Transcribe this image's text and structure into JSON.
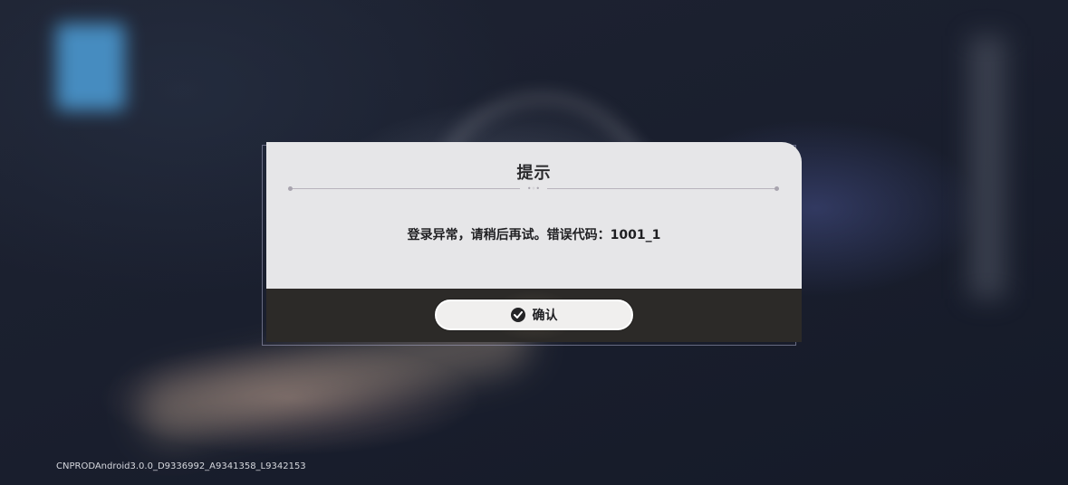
{
  "dialog": {
    "title": "提示",
    "message": "登录异常，请稍后再试。错误代码：1001_1",
    "confirm_label": "确认",
    "confirm_icon": "checkmark-circle-icon"
  },
  "footer": {
    "version": "CNPRODAndroid3.0.0_D9336992_A9341358_L9342153"
  },
  "colors": {
    "dialog_body": "#e6e6e8",
    "dialog_footer": "#2c2a28",
    "button_bg": "#f0efee",
    "text": "#1f1f22"
  }
}
